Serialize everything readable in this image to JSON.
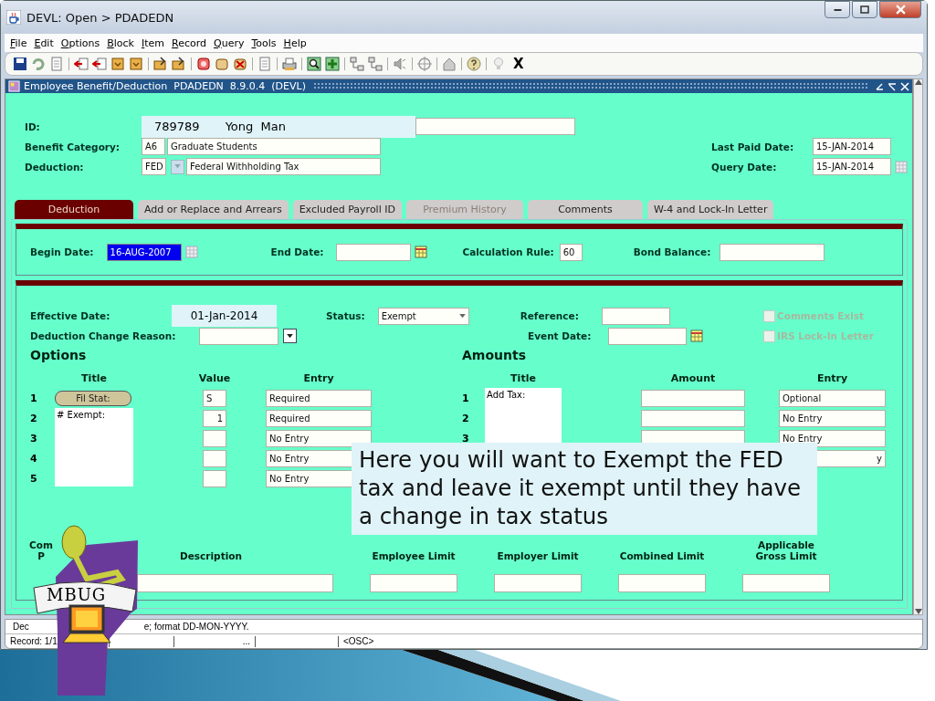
{
  "window": {
    "title": "DEVL:  Open > PDADEDN"
  },
  "menu": [
    {
      "label": "File"
    },
    {
      "label": "Edit"
    },
    {
      "label": "Options"
    },
    {
      "label": "Block"
    },
    {
      "label": "Item"
    },
    {
      "label": "Record"
    },
    {
      "label": "Query"
    },
    {
      "label": "Tools"
    },
    {
      "label": "Help"
    }
  ],
  "toolbar": {
    "exit_label": "X"
  },
  "form": {
    "title": "Employee Benefit/Deduction  PDADEDN  8.9.0.4  (DEVL)"
  },
  "header": {
    "id_label": "ID:",
    "id": "789789",
    "name": "Yong  Man",
    "benefit_label": "Benefit Category:",
    "benefit_code": "A6",
    "benefit_desc": "Graduate Students",
    "deduction_label": "Deduction:",
    "deduction_code": "FED",
    "deduction_desc": "Federal Withholding Tax",
    "last_paid_label": "Last Paid Date:",
    "last_paid": "15-JAN-2014",
    "query_label": "Query Date:",
    "query_date": "15-JAN-2014"
  },
  "tabs": [
    {
      "label": "Deduction",
      "selected": true,
      "disabled": false
    },
    {
      "label": "Add or Replace and Arrears",
      "selected": false,
      "disabled": false
    },
    {
      "label": "Excluded Payroll ID",
      "selected": false,
      "disabled": false
    },
    {
      "label": "Premium History",
      "selected": false,
      "disabled": true
    },
    {
      "label": "Comments",
      "selected": false,
      "disabled": false
    },
    {
      "label": "W-4 and Lock-In Letter",
      "selected": false,
      "disabled": false
    }
  ],
  "dates": {
    "begin_label": "Begin Date:",
    "begin": "16-AUG-2007",
    "end_label": "End Date:",
    "rule_label": "Calculation Rule:",
    "rule": "60",
    "bond_label": "Bond Balance:"
  },
  "detail": {
    "effective_label": "Effective Date:",
    "effective": "01-Jan-2014",
    "status_label": "Status:",
    "status": "Exempt",
    "reason_label": "Deduction Change Reason:",
    "reference_label": "Reference:",
    "event_label": "Event Date:",
    "checkboxes": [
      {
        "label": "Comments Exist",
        "checked": false,
        "disabled": true
      },
      {
        "label": "IRS Lock-In Letter",
        "checked": false,
        "disabled": true
      }
    ]
  },
  "options": {
    "heading": "Options",
    "columns": [
      "Title",
      "Value",
      "Entry"
    ],
    "rows": [
      {
        "number": "1",
        "title": "Fil Stat:",
        "kind": "button",
        "value": "S",
        "entry": "Required"
      },
      {
        "number": "2",
        "title": "# Exempt:",
        "kind": "text",
        "value": "1",
        "entry": "Required"
      },
      {
        "number": "3",
        "kind": "text",
        "entry": "No Entry"
      },
      {
        "number": "4",
        "kind": "text",
        "entry": "No Entry"
      },
      {
        "number": "5",
        "kind": "text",
        "entry": "No Entry"
      }
    ]
  },
  "amounts": {
    "heading": "Amounts",
    "columns": [
      "Title",
      "Amount",
      "Entry"
    ],
    "rows": [
      {
        "number": "1",
        "title": "Add Tax:",
        "entry": "Optional"
      },
      {
        "number": "2",
        "entry": "No Entry"
      },
      {
        "number": "3",
        "entry": "No Entry"
      },
      {
        "entry": "y"
      }
    ]
  },
  "limits": {
    "column_1": [
      "Com",
      "P"
    ],
    "columns": [
      "Description",
      "Employee Limit",
      "Employer Limit",
      "Combined Limit"
    ],
    "last_column": [
      "Applicable",
      "Gross Limit"
    ]
  },
  "callout": "Here you will want to Exempt the FED tax and leave it exempt until they have a change in tax status",
  "logo": {
    "text": "MBUG"
  },
  "status_bar": {
    "hint_start": "Dec",
    "hint_end": "e; format DD-MON-YYYY.",
    "record": "Record: 1/1",
    "ellipsis": "...",
    "mode": "<OSC>"
  }
}
